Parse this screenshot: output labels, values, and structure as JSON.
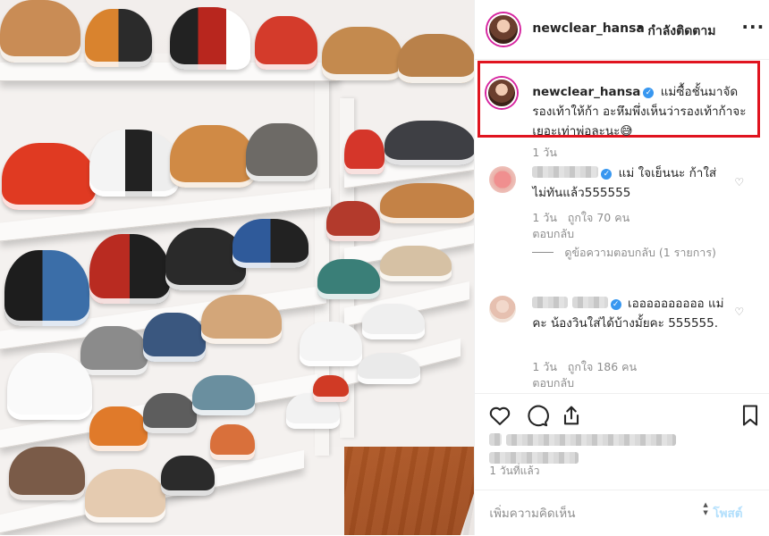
{
  "header": {
    "username": "newclear_hansa",
    "separator": "•",
    "follow_status": "กำลังติดตาม",
    "more_icon": "ellipsis-icon"
  },
  "caption": {
    "username": "newclear_hansa",
    "text": "แม่ซื้อชั้นมาจัดรองเท้าให้ก้า อะหึมพึ่งเห็นว่ารองเท้าก้าจะเยอะเท่าพ่อละนะ😅",
    "time": "1 วัน",
    "highlight_color": "#e0141f"
  },
  "comments": [
    {
      "text": "แม่ ใจเย็นนะ ก้าใส่ไม่ทันแล้ว555555",
      "time": "1 วัน",
      "likes": "ถูกใจ 70 คน",
      "reply": "ตอบกลับ",
      "view_replies": "ดูข้อความตอบกลับ (1 รายการ)"
    },
    {
      "text": "เออออออออออ แม่คะ น้องวินใส่ได้บ้างมั้ยคะ 555555.",
      "time": "1 วัน",
      "likes": "ถูกใจ 186 คน",
      "reply": "ตอบกลับ"
    }
  ],
  "actions": {
    "like_icon": "heart-icon",
    "comment_icon": "comment-icon",
    "share_icon": "share-icon",
    "save_icon": "bookmark-icon"
  },
  "post_date": "1 วันที่แล้ว",
  "add_comment": {
    "placeholder": "เพิ่มความคิดเห็น",
    "post_label": "โพสต์"
  },
  "colors": {
    "verified": "#3897f0",
    "story_ring": "#d6249f"
  }
}
